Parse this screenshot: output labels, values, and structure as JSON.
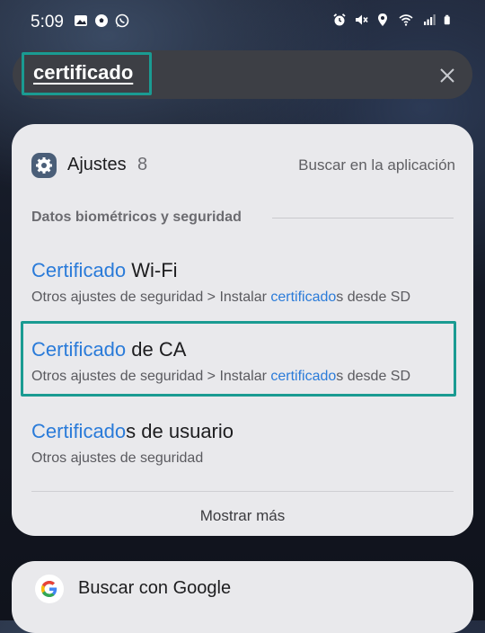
{
  "status_bar": {
    "time": "5:09",
    "left_icons": [
      "image-icon",
      "soccer-ball-icon",
      "whatsapp-icon"
    ],
    "right_icons": [
      "alarm-icon",
      "mute-icon",
      "location-icon",
      "wifi-icon",
      "signal-icon",
      "battery-icon"
    ]
  },
  "search": {
    "query": "certificado",
    "clear_icon": "close-icon"
  },
  "results": {
    "app_name": "Ajustes",
    "app_count": "8",
    "app_icon": "gear-icon",
    "search_in_app": "Buscar en la aplicación",
    "section_header": "Datos biométricos y seguridad",
    "items": [
      {
        "title_hl": "Certificado",
        "title_rest": " Wi-Fi",
        "sub_pre": "Otros ajustes de seguridad > Instalar ",
        "sub_hl": "certificado",
        "sub_post": "s desde SD"
      },
      {
        "title_hl": "Certificado",
        "title_rest": " de CA",
        "sub_pre": "Otros ajustes de seguridad > Instalar ",
        "sub_hl": "certificado",
        "sub_post": "s desde SD"
      },
      {
        "title_hl": "Certificado",
        "title_rest": "s de usuario",
        "sub_pre": "Otros ajustes de seguridad",
        "sub_hl": "",
        "sub_post": ""
      }
    ],
    "show_more": "Mostrar más"
  },
  "google": {
    "label": "Buscar con Google",
    "logo_icon": "google-g-icon"
  },
  "colors": {
    "highlight_text": "#2a7bd9",
    "annotation_box": "#1a9b92",
    "card_bg": "#e9e9ec"
  }
}
